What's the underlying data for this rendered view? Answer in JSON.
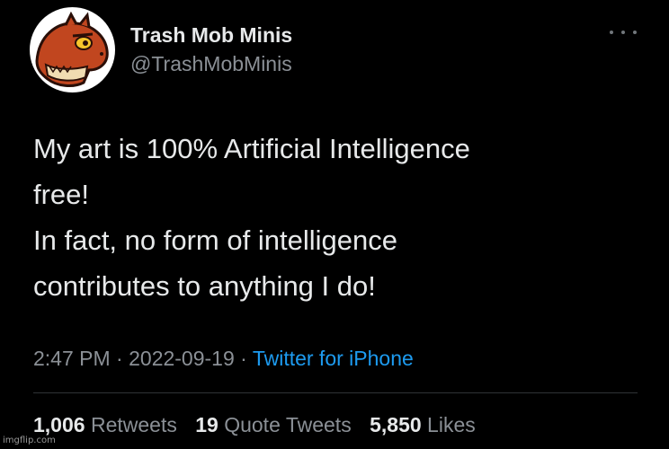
{
  "user": {
    "display_name": "Trash Mob Minis",
    "handle": "@TrashMobMinis",
    "avatar_icon": "dinosaur-avatar-icon"
  },
  "tweet": {
    "lines": [
      "My art is 100% Artificial Intelligence",
      "free!",
      "In fact, no form of intelligence",
      "contributes to anything I do!"
    ],
    "time": "2:47 PM",
    "date": "2022-09-19",
    "separator": "·",
    "source": "Twitter for iPhone"
  },
  "stats": {
    "retweets_count": "1,006",
    "retweets_label": "Retweets",
    "quote_count": "19",
    "quote_label": "Quote Tweets",
    "likes_count": "5,850",
    "likes_label": "Likes"
  },
  "watermark": "imgflip.com",
  "colors": {
    "background": "#000000",
    "text": "#e7e9ea",
    "secondary": "#8b9096",
    "link": "#1d9bf0"
  }
}
